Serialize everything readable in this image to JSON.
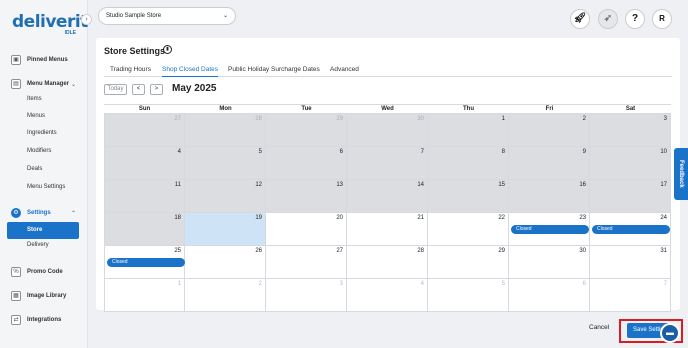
{
  "brand": {
    "logo_text": "deliverit",
    "logo_sub": "IDLE"
  },
  "sidebar": {
    "pinned": "Pinned Menus",
    "menu_manager": "Menu Manager",
    "menu_items": [
      "Items",
      "Menus",
      "Ingredients",
      "Modifiers",
      "Deals",
      "Menu Settings"
    ],
    "settings": "Settings",
    "settings_items": [
      "Store",
      "Delivery"
    ],
    "promo": "Promo Code",
    "image_library": "Image Library",
    "integrations": "Integrations"
  },
  "topbar": {
    "store_name": "Studio Sample Store",
    "help_icon": "?",
    "user_initial": "R"
  },
  "page": {
    "title": "Store Settings",
    "tabs": [
      "Trading Hours",
      "Shop Closed Dates",
      "Public Holiday Surcharge Dates",
      "Advanced"
    ],
    "active_tab": "Shop Closed Dates"
  },
  "calendar": {
    "today_label": "Today",
    "prev": "<",
    "next": ">",
    "month_label": "May 2025",
    "weekdays": [
      "Sun",
      "Mon",
      "Tue",
      "Wed",
      "Thu",
      "Fri",
      "Sat"
    ],
    "event_label": "Closed",
    "weeks": [
      [
        {
          "d": "27",
          "past": true,
          "other": true
        },
        {
          "d": "28",
          "past": true,
          "other": true
        },
        {
          "d": "29",
          "past": true,
          "other": true
        },
        {
          "d": "30",
          "past": true,
          "other": true
        },
        {
          "d": "1",
          "past": true
        },
        {
          "d": "2",
          "past": true
        },
        {
          "d": "3",
          "past": true
        }
      ],
      [
        {
          "d": "4",
          "past": true
        },
        {
          "d": "5",
          "past": true
        },
        {
          "d": "6",
          "past": true
        },
        {
          "d": "7",
          "past": true
        },
        {
          "d": "8",
          "past": true
        },
        {
          "d": "9",
          "past": true
        },
        {
          "d": "10",
          "past": true
        }
      ],
      [
        {
          "d": "11",
          "past": true
        },
        {
          "d": "12",
          "past": true
        },
        {
          "d": "13",
          "past": true
        },
        {
          "d": "14",
          "past": true
        },
        {
          "d": "15",
          "past": true
        },
        {
          "d": "16",
          "past": true
        },
        {
          "d": "17",
          "past": true
        }
      ],
      [
        {
          "d": "18",
          "past": true
        },
        {
          "d": "19",
          "today": true
        },
        {
          "d": "20"
        },
        {
          "d": "21"
        },
        {
          "d": "22"
        },
        {
          "d": "23",
          "event": "Closed"
        },
        {
          "d": "24",
          "event": "Closed"
        }
      ],
      [
        {
          "d": "25",
          "event": "Closed"
        },
        {
          "d": "26"
        },
        {
          "d": "27"
        },
        {
          "d": "28"
        },
        {
          "d": "29"
        },
        {
          "d": "30"
        },
        {
          "d": "31"
        }
      ],
      [
        {
          "d": "1",
          "other": true
        },
        {
          "d": "2",
          "other": true
        },
        {
          "d": "3",
          "other": true
        },
        {
          "d": "4",
          "other": true
        },
        {
          "d": "5",
          "other": true
        },
        {
          "d": "6",
          "other": true
        },
        {
          "d": "7",
          "other": true
        }
      ]
    ]
  },
  "footer": {
    "cancel": "Cancel",
    "save": "Save Settings"
  },
  "feedback": "Feedback",
  "colors": {
    "accent": "#1b73c9",
    "highlight": "#d61d24",
    "past_day": "#dcdde0",
    "today": "#cfe3f6"
  }
}
